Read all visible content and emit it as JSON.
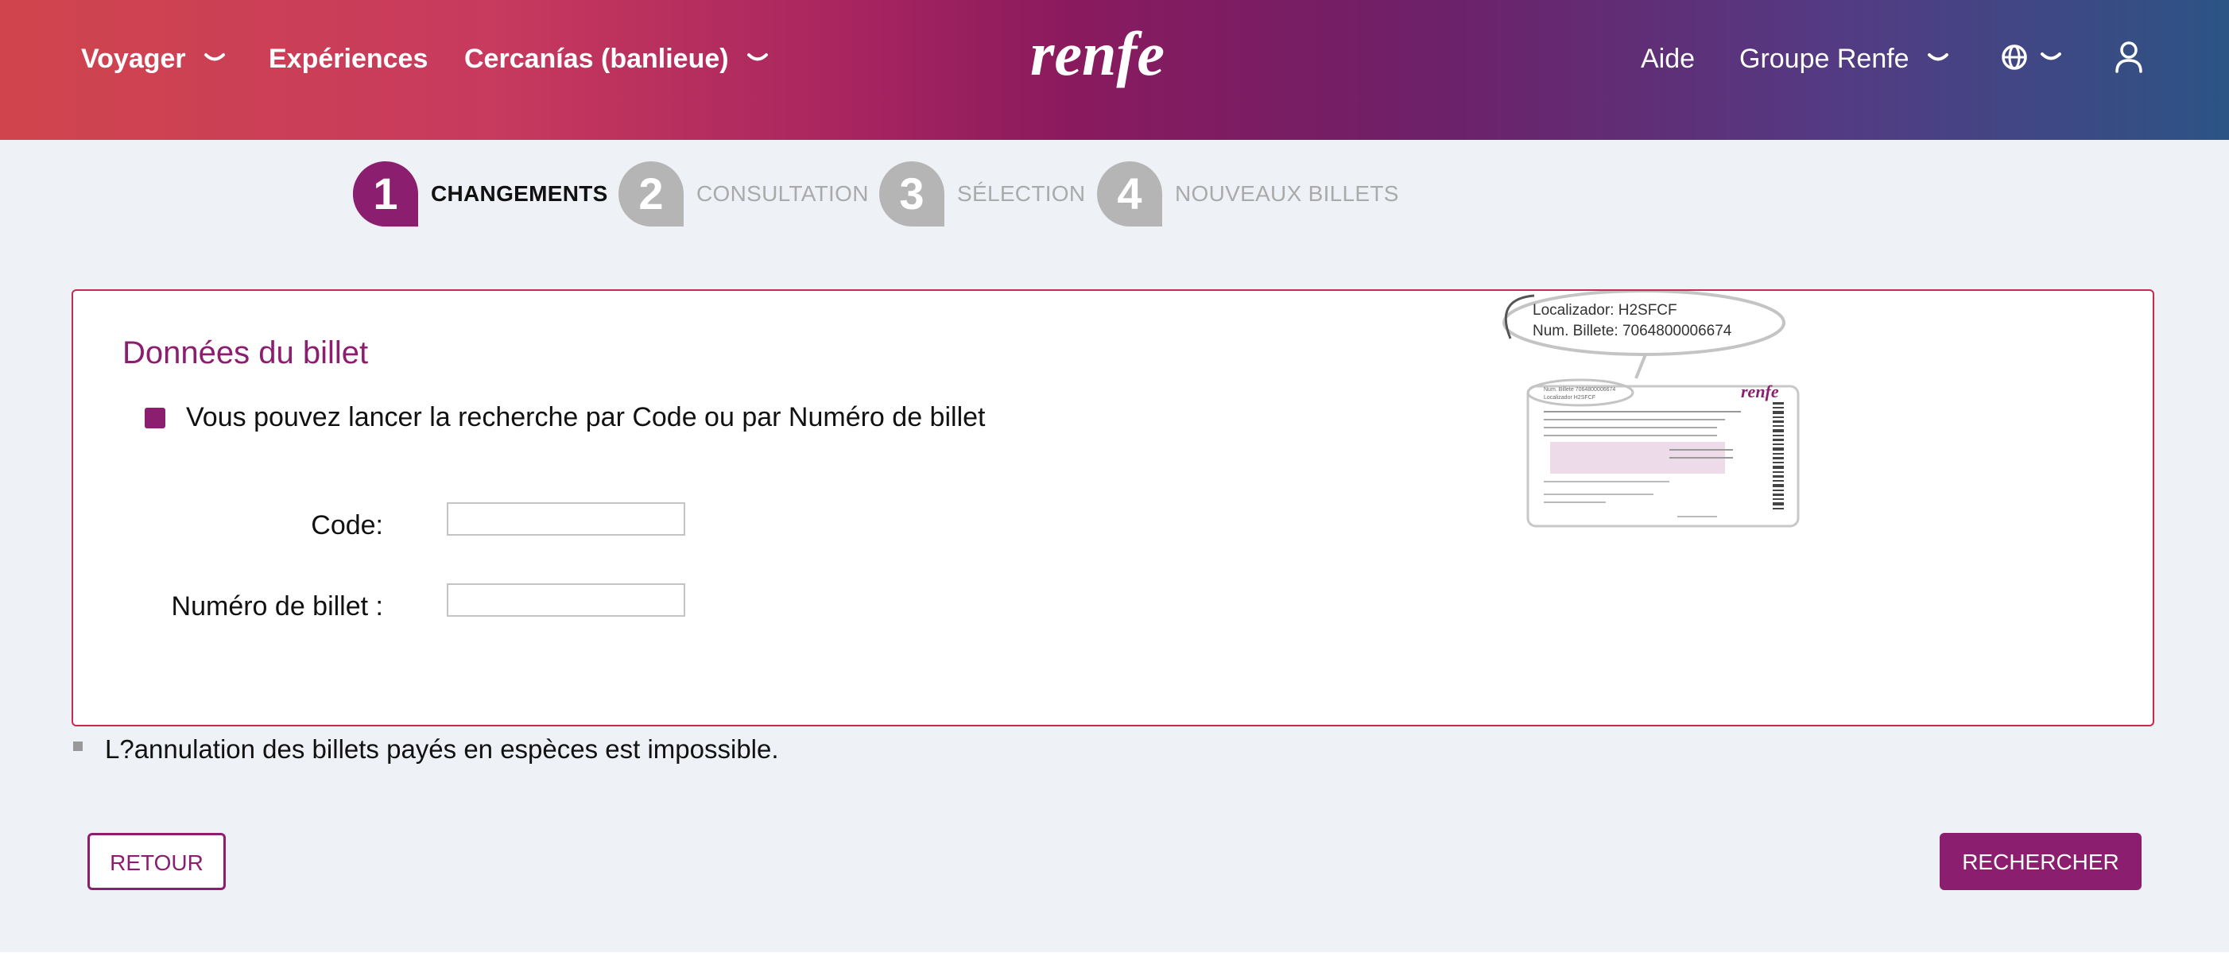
{
  "header": {
    "nav": [
      {
        "label": "Voyager",
        "has_dropdown": true
      },
      {
        "label": "Expériences",
        "has_dropdown": false
      },
      {
        "label": "Cercanías (banlieue)",
        "has_dropdown": true
      }
    ],
    "logo_text": "renfe",
    "right": [
      {
        "label": "Aide",
        "has_dropdown": false
      },
      {
        "label": "Groupe Renfe",
        "has_dropdown": true
      }
    ],
    "icons": [
      "globe-icon",
      "chevron-down-icon",
      "user-icon"
    ],
    "gradient_colors": [
      "#d0454d",
      "#8a1a5e",
      "#2c5485"
    ]
  },
  "stepper": {
    "steps": [
      {
        "number": "1",
        "label": "CHANGEMENTS",
        "active": true
      },
      {
        "number": "2",
        "label": "CONSULTATION",
        "active": false
      },
      {
        "number": "3",
        "label": "SÉLECTION",
        "active": false
      },
      {
        "number": "4",
        "label": "NOUVEAUX BILLETS",
        "active": false
      }
    ],
    "active_color": "#8b1e6e",
    "inactive_color": "#b5b5b5"
  },
  "form": {
    "title": "Données du billet",
    "hint": "Vous pouvez lancer la recherche par Code  ou par Numéro de billet",
    "fields": [
      {
        "label": "Code:",
        "value": "",
        "placeholder": ""
      },
      {
        "label": "Numéro de billet :",
        "value": "",
        "placeholder": ""
      }
    ],
    "illustration": {
      "bubble_line1": "Localizador: H2SFCF",
      "bubble_line2": "Num. Billete: 7064800006674",
      "ticket_brand": "renfe"
    },
    "border_color": "#c8294e"
  },
  "notice": "L?annulation des billets payés en espèces est impossible.",
  "buttons": {
    "back": "RETOUR",
    "search": "RECHERCHER"
  },
  "accent_color": "#8b1e6e"
}
